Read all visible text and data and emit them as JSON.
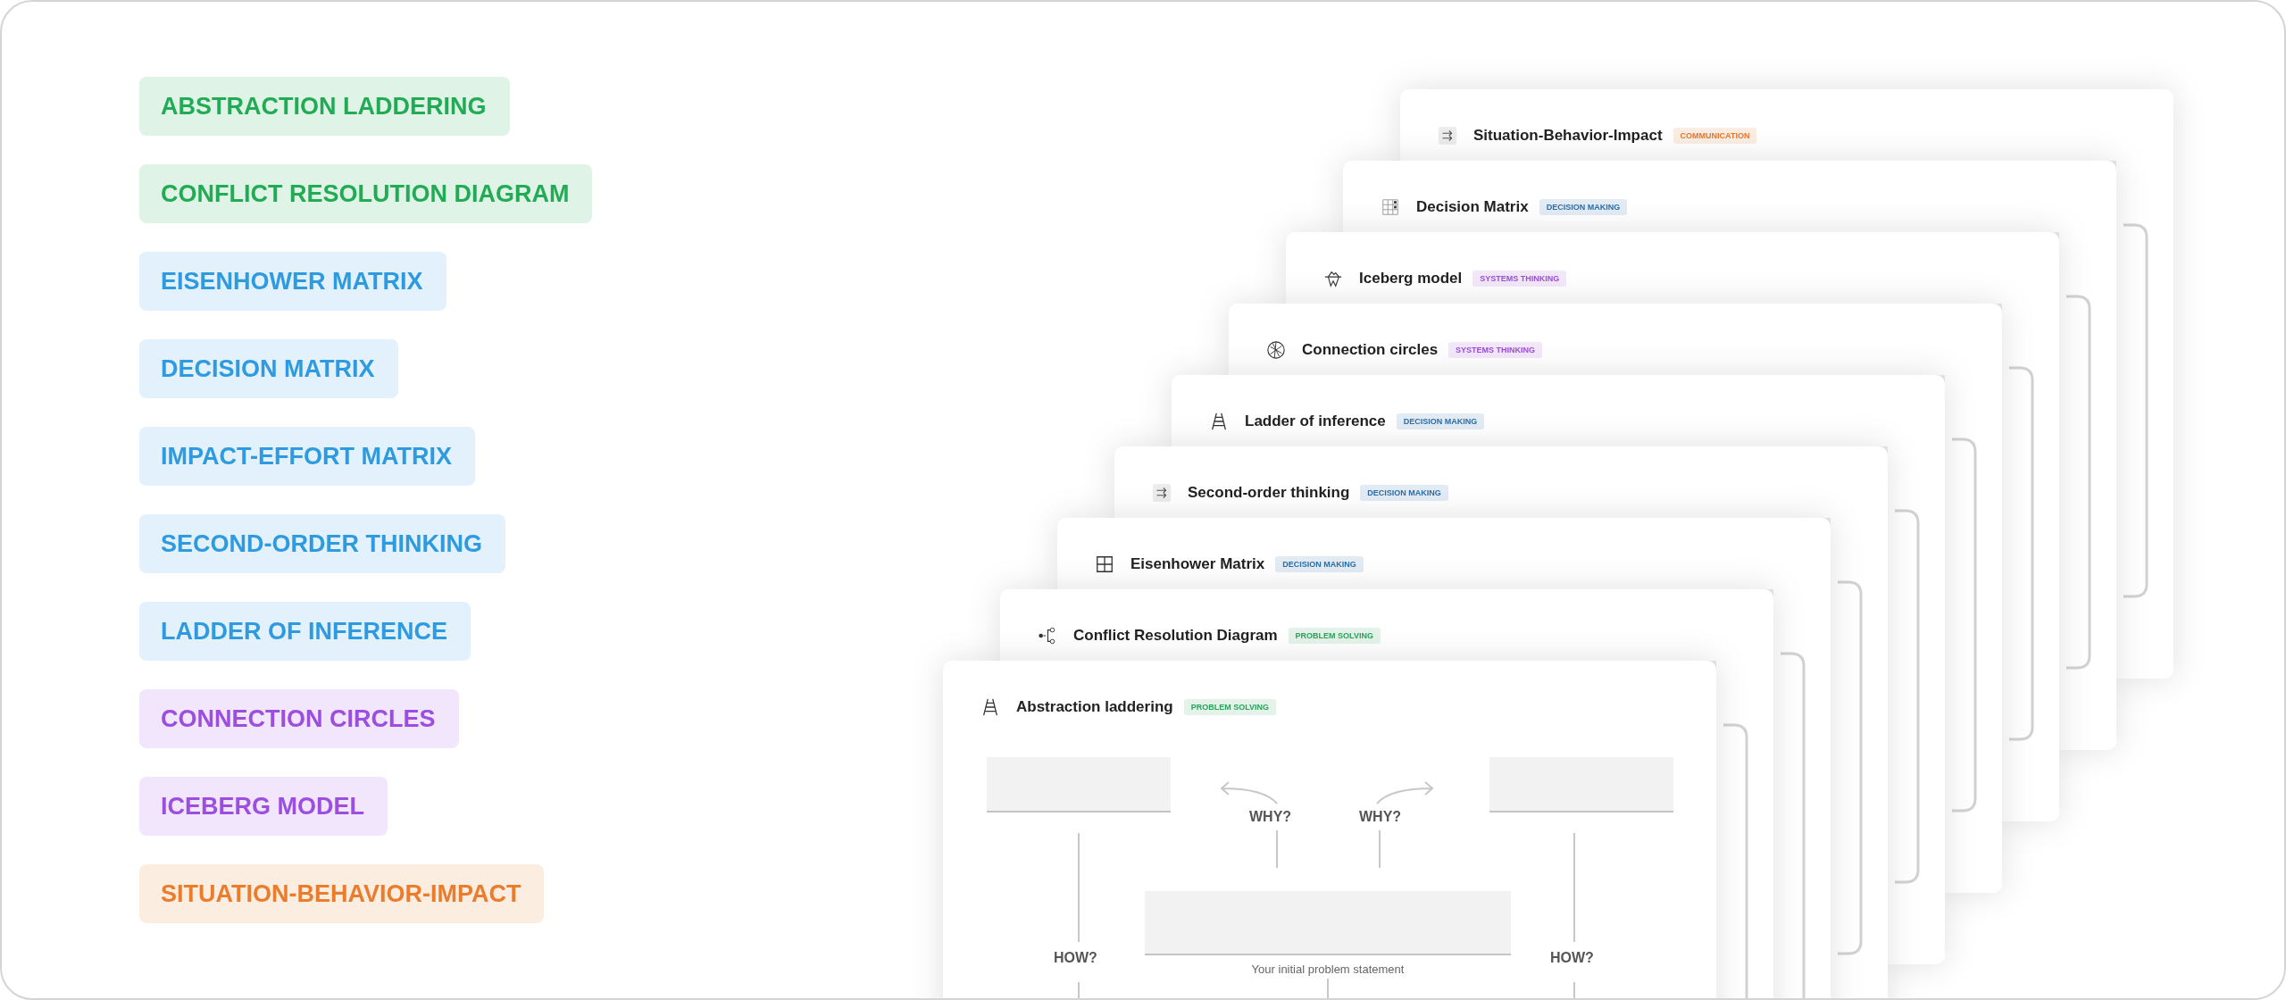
{
  "tags": [
    {
      "label": "ABSTRACTION LADDERING",
      "color": "#22ab55"
    },
    {
      "label": "CONFLICT RESOLUTION DIAGRAM",
      "color": "#22ab55"
    },
    {
      "label": "EISENHOWER MATRIX",
      "color": "#2e9ae0"
    },
    {
      "label": "DECISION MATRIX",
      "color": "#2e9ae0"
    },
    {
      "label": "IMPACT-EFFORT MATRIX",
      "color": "#2e9ae0"
    },
    {
      "label": "SECOND-ORDER THINKING",
      "color": "#2e9ae0"
    },
    {
      "label": "LADDER OF INFERENCE",
      "color": "#2e9ae0"
    },
    {
      "label": "CONNECTION CIRCLES",
      "color": "#9b4ee0"
    },
    {
      "label": "ICEBERG MODEL",
      "color": "#9b4ee0"
    },
    {
      "label": "SITUATION-BEHAVIOR-IMPACT",
      "color": "#ea7c2c"
    }
  ],
  "cards": [
    {
      "title": "Situation-Behavior-Impact",
      "kind": "arrows",
      "badge": {
        "label": "COMMUNICATION",
        "color": "#e8772a"
      }
    },
    {
      "title": "Decision Matrix",
      "kind": "table",
      "badge": {
        "label": "DECISION MAKING",
        "color": "#2a6fa8"
      }
    },
    {
      "title": "Iceberg model",
      "kind": "iceberg",
      "badge": {
        "label": "SYSTEMS THINKING",
        "color": "#9b4fd6"
      }
    },
    {
      "title": "Connection circles",
      "kind": "circle",
      "badge": {
        "label": "SYSTEMS THINKING",
        "color": "#9b4fd6"
      }
    },
    {
      "title": "Ladder of inference",
      "kind": "ladder",
      "badge": {
        "label": "DECISION MAKING",
        "color": "#2a6fa8"
      }
    },
    {
      "title": "Second-order thinking",
      "kind": "arrows",
      "badge": {
        "label": "DECISION MAKING",
        "color": "#2a6fa8"
      }
    },
    {
      "title": "Eisenhower Matrix",
      "kind": "grid",
      "badge": {
        "label": "DECISION MAKING",
        "color": "#2a6fa8"
      }
    },
    {
      "title": "Conflict Resolution Diagram",
      "kind": "branch",
      "badge": {
        "label": "PROBLEM SOLVING",
        "color": "#2aa35a"
      }
    },
    {
      "title": "Abstraction laddering",
      "kind": "ladder",
      "badge": {
        "label": "PROBLEM SOLVING",
        "color": "#2aa35a"
      }
    }
  ],
  "diagram": {
    "why_labels": [
      "WHY?",
      "WHY?"
    ],
    "how_labels": [
      "HOW?",
      "HOW?"
    ],
    "caption": "Your initial problem statement"
  }
}
